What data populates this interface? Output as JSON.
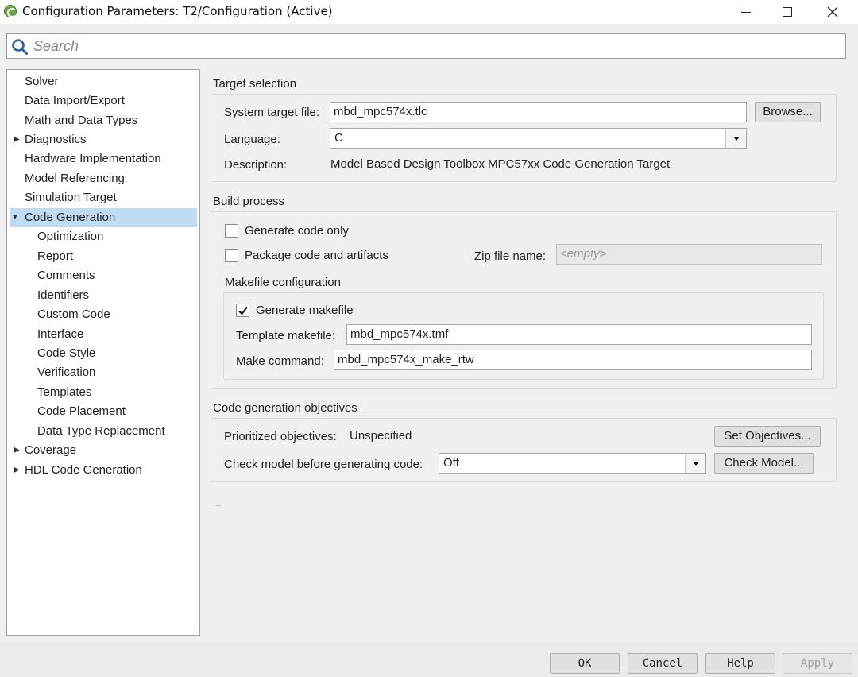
{
  "window": {
    "title": "Configuration Parameters: T2/Configuration (Active)"
  },
  "search": {
    "placeholder": "Search"
  },
  "tree": {
    "items": [
      {
        "label": "Solver"
      },
      {
        "label": "Data Import/Export"
      },
      {
        "label": "Math and Data Types"
      },
      {
        "label": "Diagnostics"
      },
      {
        "label": "Hardware Implementation"
      },
      {
        "label": "Model Referencing"
      },
      {
        "label": "Simulation Target"
      },
      {
        "label": "Code Generation"
      },
      {
        "label": "Optimization"
      },
      {
        "label": "Report"
      },
      {
        "label": "Comments"
      },
      {
        "label": "Identifiers"
      },
      {
        "label": "Custom Code"
      },
      {
        "label": "Interface"
      },
      {
        "label": "Code Style"
      },
      {
        "label": "Verification"
      },
      {
        "label": "Templates"
      },
      {
        "label": "Code Placement"
      },
      {
        "label": "Data Type Replacement"
      },
      {
        "label": "Coverage"
      },
      {
        "label": "HDL Code Generation"
      }
    ],
    "selected": "Code Generation"
  },
  "target_selection": {
    "title": "Target selection",
    "system_target_label": "System target file:",
    "system_target_value": "mbd_mpc574x.tlc",
    "browse_label": "Browse...",
    "language_label": "Language:",
    "language_value": "C",
    "description_label": "Description:",
    "description_value": "Model Based Design Toolbox MPC57xx Code Generation Target"
  },
  "build_process": {
    "title": "Build process",
    "generate_code_only_label": "Generate code only",
    "generate_code_only_checked": false,
    "package_code_label": "Package code and artifacts",
    "package_code_checked": false,
    "zip_label": "Zip file name:",
    "zip_placeholder": "<empty>",
    "makefile_title": "Makefile configuration",
    "generate_makefile_label": "Generate makefile",
    "generate_makefile_checked": true,
    "template_makefile_label": "Template makefile:",
    "template_makefile_value": "mbd_mpc574x.tmf",
    "make_command_label": "Make command:",
    "make_command_value": "mbd_mpc574x_make_rtw"
  },
  "objectives": {
    "title": "Code generation objectives",
    "prioritized_label": "Prioritized objectives:",
    "prioritized_value": "Unspecified",
    "set_objectives_label": "Set Objectives...",
    "check_model_label": "Check model before generating code:",
    "check_model_value": "Off",
    "check_model_button_label": "Check Model..."
  },
  "ellipsis": "...",
  "buttons": {
    "ok": "OK",
    "cancel": "Cancel",
    "help": "Help",
    "apply": "Apply"
  },
  "colors": {
    "selection": "#c0dcf3",
    "background": "#f0f0f0"
  }
}
